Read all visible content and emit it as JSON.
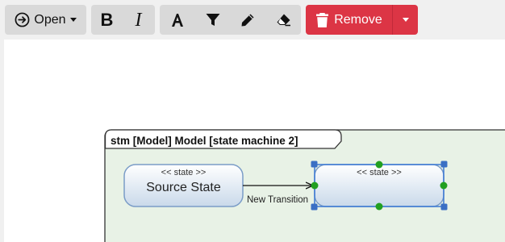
{
  "toolbar": {
    "open_label": "Open",
    "bold_glyph": "B",
    "italic_glyph": "I",
    "remove_label": "Remove",
    "icons": [
      "circle-arrow-right-icon",
      "chevron-down-icon",
      "bold-icon",
      "italic-icon",
      "font-color-icon",
      "fill-color-icon",
      "pencil-icon",
      "eraser-icon",
      "trash-icon"
    ],
    "remove_color": "#dc3545"
  },
  "diagram": {
    "frame_label": "stm [Model] Model [state machine 2]",
    "frame_fill": "#e8f2e6",
    "source_state": {
      "stereotype": "<< state >>",
      "name": "Source State"
    },
    "target_state": {
      "stereotype": "<< state >>",
      "name": ""
    },
    "transition_label": "New Transition",
    "selection_color": "#3a78d4",
    "handle_corner_color": "#3a6fc4",
    "handle_mid_color": "#22a020"
  }
}
